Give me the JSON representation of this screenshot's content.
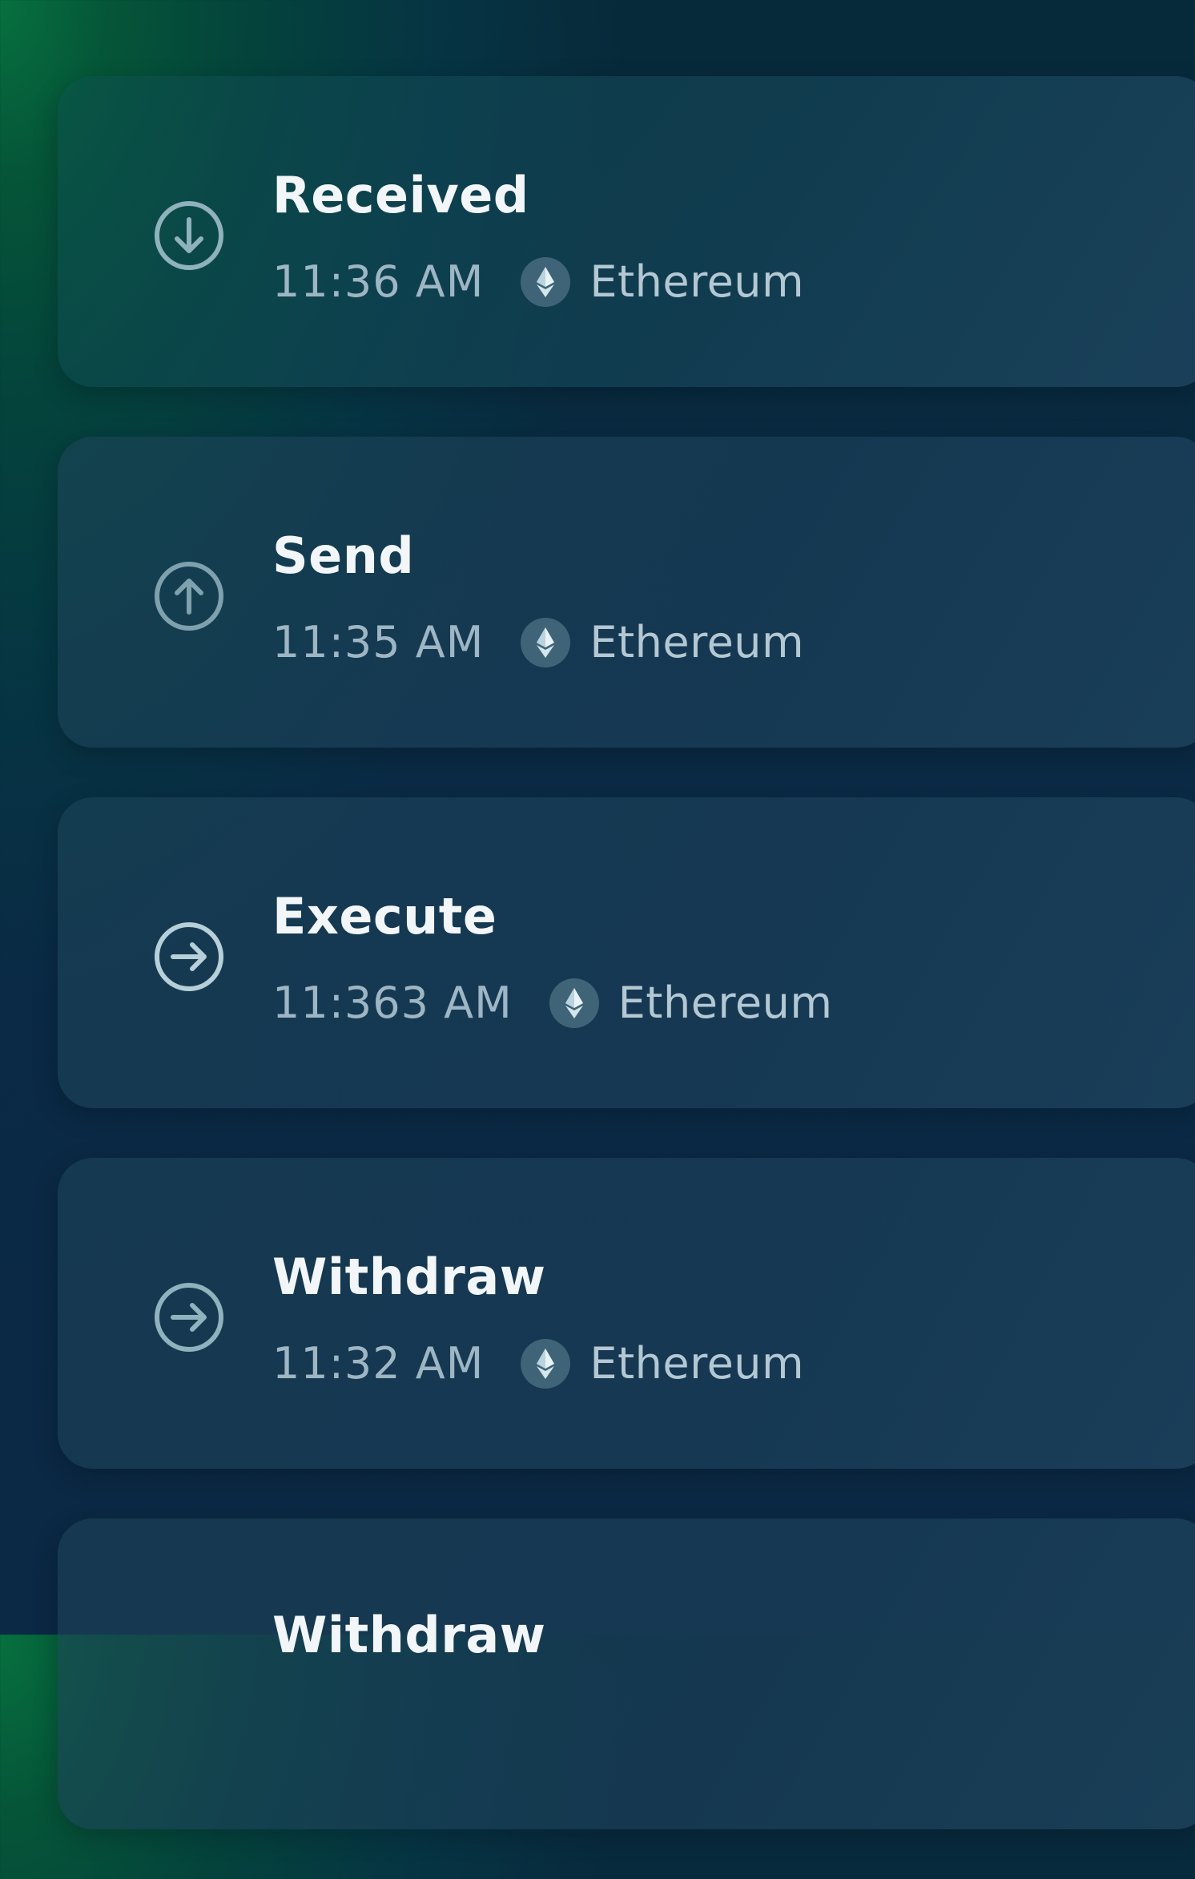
{
  "transactions": [
    {
      "title": "Received",
      "time": "11:36 AM",
      "chain": "Ethereum",
      "icon": "arrow-down-circle-icon"
    },
    {
      "title": "Send",
      "time": "11:35 AM",
      "chain": "Ethereum",
      "icon": "arrow-up-circle-icon"
    },
    {
      "title": "Execute",
      "time": "11:363 AM",
      "chain": "Ethereum",
      "icon": "arrow-right-circle-icon"
    },
    {
      "title": "Withdraw",
      "time": "11:32 AM",
      "chain": "Ethereum",
      "icon": "arrow-right-circle-icon"
    },
    {
      "title": "Withdraw",
      "time": "",
      "chain": "",
      "icon": "arrow-right-circle-icon"
    }
  ],
  "colors": {
    "title": "#f2f6f8",
    "meta": "#9eb6c4",
    "icon_stroke": "#8fb2bd",
    "card": "#1e4560"
  }
}
